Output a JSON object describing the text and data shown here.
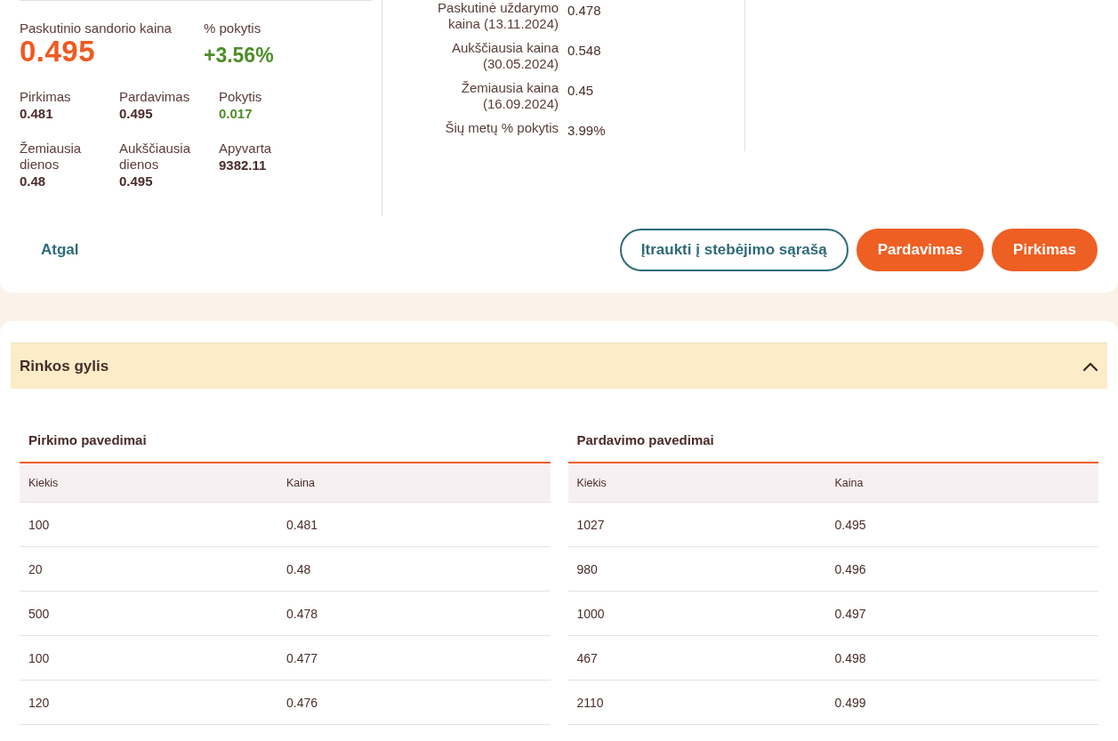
{
  "quote": {
    "last_price": {
      "label": "Paskutinio sandorio kaina",
      "value": "0.495"
    },
    "change_pct": {
      "label": "% pokytis",
      "value": "+3.56%",
      "kind": "positive"
    },
    "stats": [
      {
        "label": "Pirkimas",
        "value": "0.481",
        "kind": "plain"
      },
      {
        "label": "Pardavimas",
        "value": "0.495",
        "kind": "plain"
      },
      {
        "label": "Pokytis",
        "value": "0.017",
        "kind": "positive"
      },
      {
        "label": "Žemiausia dienos",
        "value": "0.48",
        "kind": "plain"
      },
      {
        "label": "Aukščiausia dienos",
        "value": "0.495",
        "kind": "plain"
      },
      {
        "label": "Apyvarta",
        "value": "9382.11",
        "kind": "plain"
      }
    ]
  },
  "history": [
    {
      "label": "Paskutinė uždarymo kaina (13.11.2024)",
      "value": "0.478"
    },
    {
      "label": "Aukščiausia kaina (30.05.2024)",
      "value": "0.548"
    },
    {
      "label": "Žemiausia kaina (16.09.2024)",
      "value": "0.45"
    },
    {
      "label": "Šių metų % pokytis",
      "value": "3.99%"
    }
  ],
  "actions": {
    "back": "Atgal",
    "buttons": [
      {
        "label": "Įtraukti į stebėjimo sąrašą",
        "kind": "outline"
      },
      {
        "label": "Pardavimas",
        "kind": "primary"
      },
      {
        "label": "Pirkimas",
        "kind": "primary"
      }
    ]
  },
  "market_depth": {
    "title": "Rinkos gylis",
    "expanded": true,
    "tables": [
      {
        "title": "Pirkimo pavedimai",
        "columns": [
          "Kiekis",
          "Kaina"
        ],
        "rows": [
          [
            "100",
            "0.481"
          ],
          [
            "20",
            "0.48"
          ],
          [
            "500",
            "0.478"
          ],
          [
            "100",
            "0.477"
          ],
          [
            "120",
            "0.476"
          ]
        ]
      },
      {
        "title": "Pardavimo pavedimai",
        "columns": [
          "Kiekis",
          "Kaina"
        ],
        "rows": [
          [
            "1027",
            "0.495"
          ],
          [
            "980",
            "0.496"
          ],
          [
            "1000",
            "0.497"
          ],
          [
            "467",
            "0.498"
          ],
          [
            "2110",
            "0.499"
          ]
        ]
      }
    ]
  }
}
